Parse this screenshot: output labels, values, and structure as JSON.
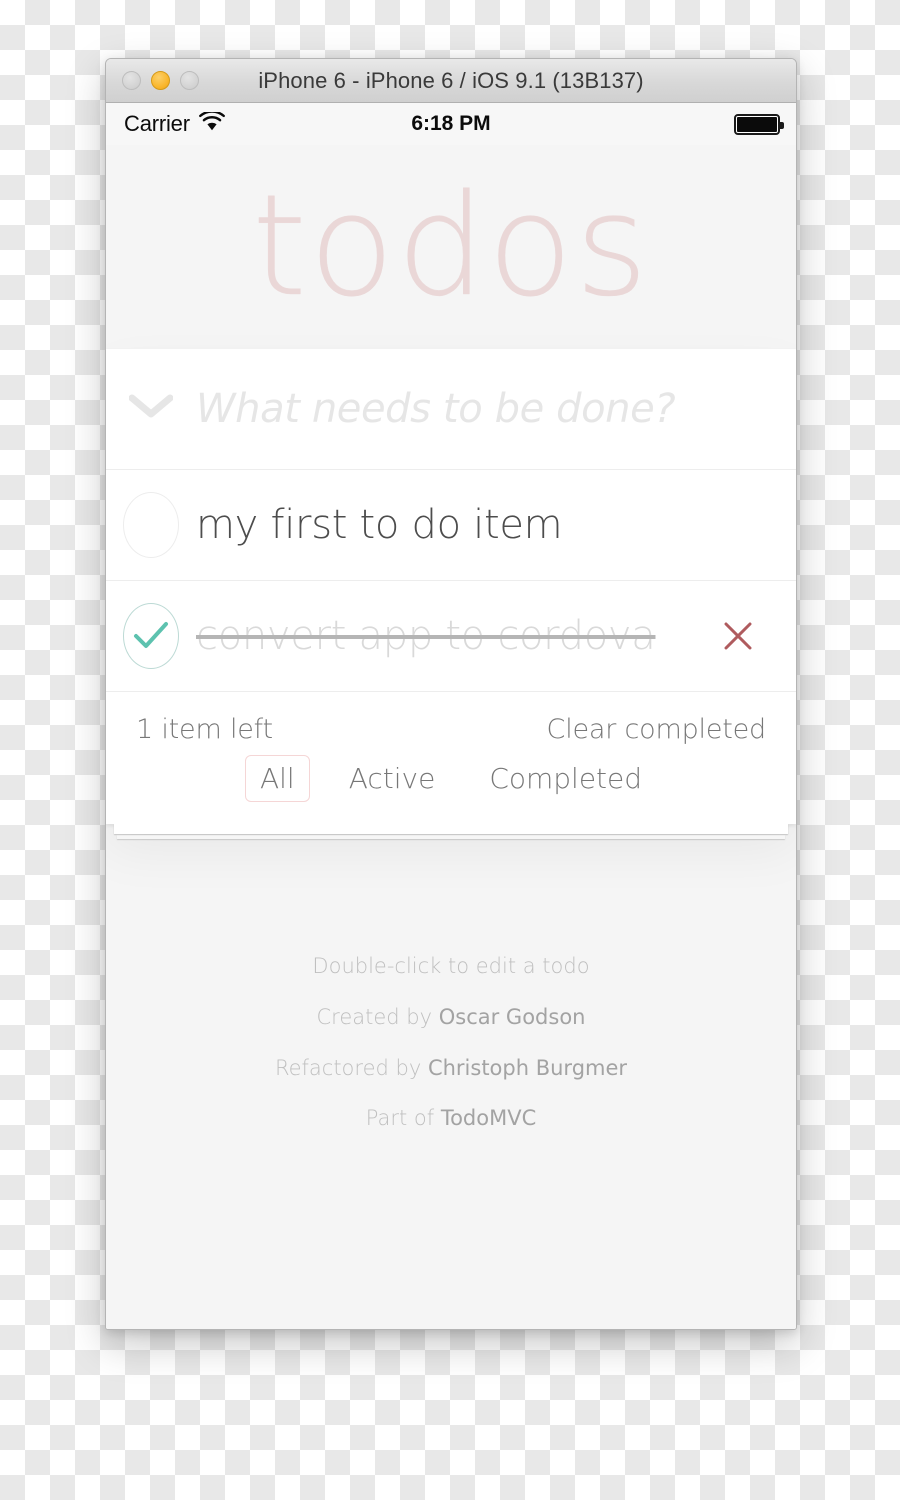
{
  "window": {
    "title": "iPhone 6 - iPhone 6 / iOS 9.1 (13B137)",
    "traffic_lights": [
      {
        "name": "close",
        "state": "inactive"
      },
      {
        "name": "minimize",
        "state": "yellow",
        "color": "#f9b52a"
      },
      {
        "name": "zoom",
        "state": "inactive"
      }
    ]
  },
  "status_bar": {
    "carrier": "Carrier",
    "wifi_icon": "wifi-icon",
    "time": "6:18 PM",
    "battery_icon": "battery-full-icon"
  },
  "app": {
    "title": "todos",
    "title_color": "#ead7d7",
    "new_todo": {
      "placeholder": "What needs to be done?",
      "value": "",
      "toggle_all_icon": "chevron-down-icon"
    },
    "todos": [
      {
        "label": "my first to do item",
        "completed": false,
        "toggle_icon": "circle-empty-icon",
        "destroy_icon": "close-icon"
      },
      {
        "label": "convert app to cordova",
        "completed": true,
        "toggle_icon": "circle-check-icon",
        "destroy_icon": "close-icon"
      }
    ],
    "footer": {
      "count_text": "1 item left",
      "clear_completed": "Clear completed",
      "filters": [
        {
          "label": "All",
          "selected": true
        },
        {
          "label": "Active",
          "selected": false
        },
        {
          "label": "Completed",
          "selected": false
        }
      ],
      "selected_border_color": "#f5d6d6"
    },
    "info": {
      "line1": "Double-click to edit a todo",
      "line2_prefix": "Created by ",
      "line2_link": "Oscar Godson",
      "line3_prefix": "Refactored by ",
      "line3_link": "Christoph Burgmer",
      "line4_prefix": "Part of ",
      "line4_link": "TodoMVC"
    }
  },
  "colors": {
    "accent_green": "#5dc2af",
    "destroy_red": "#af5b5e",
    "page_bg": "#f5f5f5"
  }
}
